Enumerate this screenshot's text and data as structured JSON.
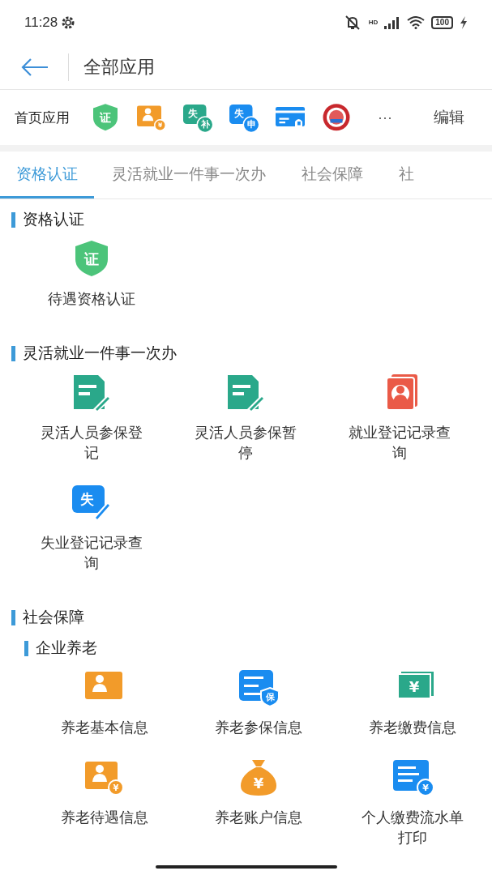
{
  "status_bar": {
    "time": "11:28",
    "network_label": "HD",
    "battery": "100"
  },
  "header": {
    "title": "全部应用"
  },
  "home_apps": {
    "label": "首页应用",
    "more": "···",
    "edit": "编辑",
    "apps": [
      {
        "kind": "shield",
        "glyphs": [
          "证"
        ]
      },
      {
        "kind": "elder-coin",
        "glyphs": [
          "¥"
        ]
      },
      {
        "kind": "sub-badge",
        "color": "#2aa88a",
        "glyphs": [
          "失",
          "补"
        ]
      },
      {
        "kind": "sub-badge",
        "color": "#1a8cf0",
        "glyphs": [
          "失",
          "申"
        ]
      },
      {
        "kind": "card"
      },
      {
        "kind": "emblem"
      }
    ]
  },
  "tabs": [
    {
      "label": "资格认证",
      "selected": true
    },
    {
      "label": "灵活就业一件事一次办",
      "selected": false
    },
    {
      "label": "社会保障",
      "selected": false
    },
    {
      "label": "社",
      "selected": false
    }
  ],
  "sections": [
    {
      "title": "资格认证",
      "items": [
        {
          "label": "待遇资格认证",
          "kind": "shield",
          "glyphs": [
            "证"
          ]
        }
      ]
    },
    {
      "title": "灵活就业一件事一次办",
      "items": [
        {
          "label": "灵活人员参保登记",
          "kind": "doc-pen"
        },
        {
          "label": "灵活人员参保暂停",
          "kind": "doc-pen"
        },
        {
          "label": "就业登记记录查询",
          "kind": "person-card"
        },
        {
          "label": "失业登记记录查询",
          "kind": "pen-badge",
          "glyphs": [
            "失"
          ]
        }
      ]
    },
    {
      "title": "社会保障",
      "subsections": [
        {
          "title": "企业养老",
          "items": [
            {
              "label": "养老基本信息",
              "kind": "elder"
            },
            {
              "label": "养老参保信息",
              "kind": "doc-shield",
              "glyphs": [
                "保"
              ]
            },
            {
              "label": "养老缴费信息",
              "kind": "banknote",
              "glyphs": [
                "¥"
              ]
            },
            {
              "label": "养老待遇信息",
              "kind": "elder-coin",
              "glyphs": [
                "¥"
              ]
            },
            {
              "label": "养老账户信息",
              "kind": "money-bag",
              "glyphs": [
                "¥"
              ]
            },
            {
              "label": "个人缴费流水单打印",
              "kind": "doc-coin",
              "glyphs": [
                "¥"
              ]
            }
          ]
        }
      ]
    }
  ]
}
